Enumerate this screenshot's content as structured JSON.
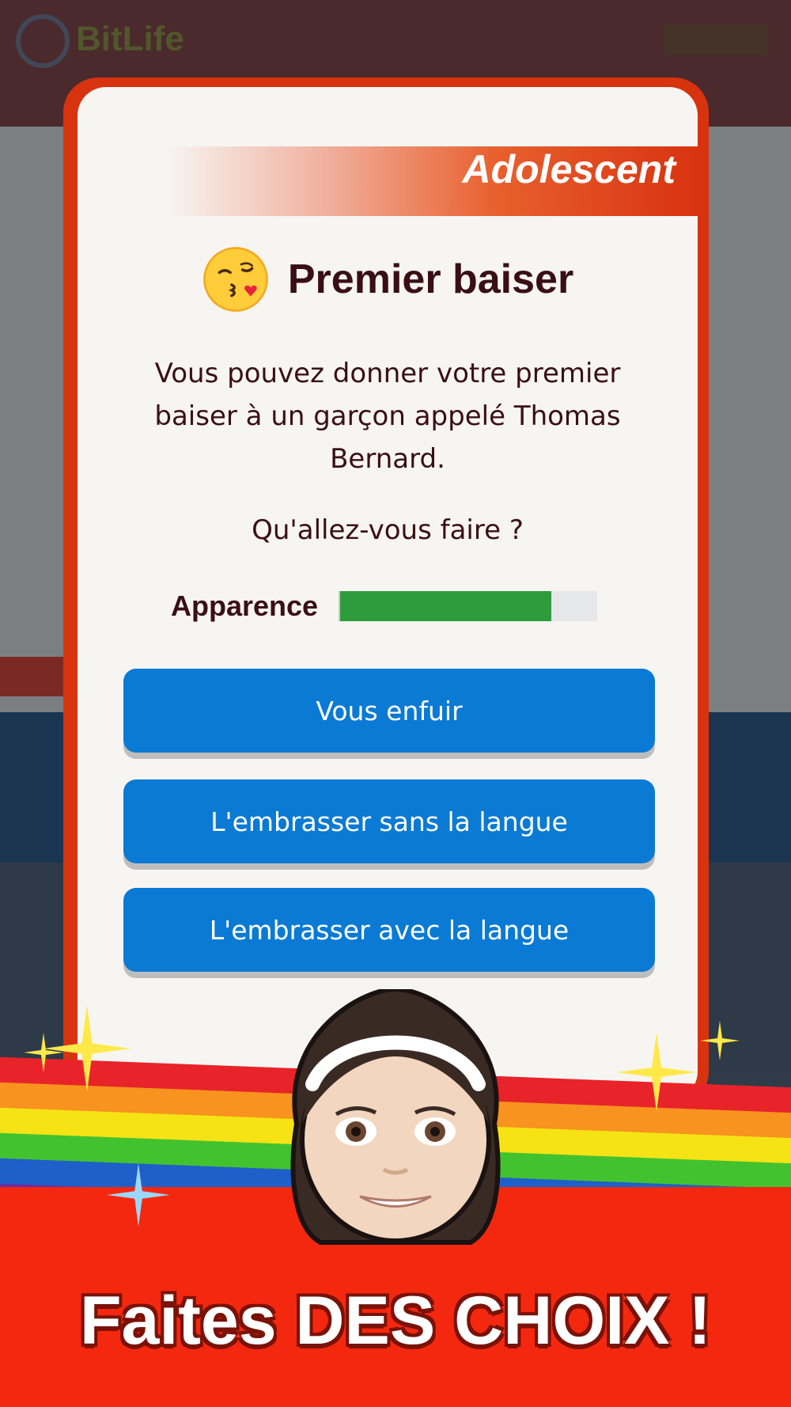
{
  "background_app": {
    "logo_text": "BitLife"
  },
  "card": {
    "stage_label": "Adolescent",
    "emoji_icon": "kissing-face-emoji",
    "title": "Premier baiser",
    "body": "Vous pouvez donner votre premier baiser à un garçon appelé Thomas Bernard.",
    "question": "Qu'allez-vous faire ?",
    "stat": {
      "label": "Apparence",
      "value_fraction": 0.82,
      "fill_color": "#2e9c3d"
    },
    "choices": [
      {
        "label": "Vous enfuir"
      },
      {
        "label": "L'embrasser sans la langue"
      },
      {
        "label": "L'embrasser avec la langue"
      }
    ]
  },
  "promo": {
    "tagline": "Faites DES CHOIX !",
    "avatar_icon": "girl-avatar"
  },
  "colors": {
    "card_border": "#d8330f",
    "button_blue": "#0a7ad4",
    "bottom_red": "#f4280f"
  }
}
